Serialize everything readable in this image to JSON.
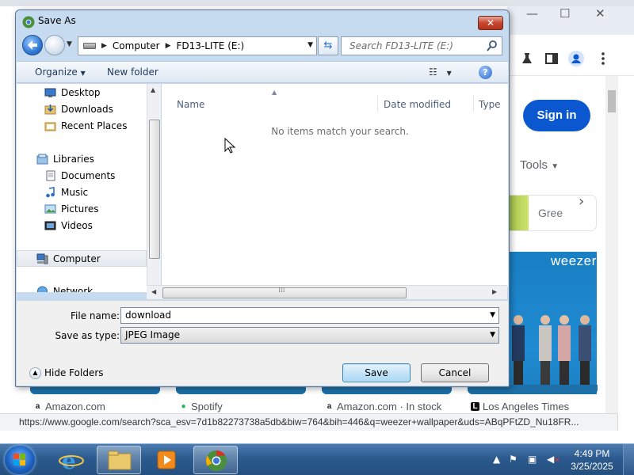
{
  "browser": {
    "window_controls": [
      "—",
      "☐",
      "✕"
    ],
    "sign_in": "Sign in",
    "tools": "Tools",
    "result_text": "Gree",
    "image_logo": "weezer",
    "sources": [
      {
        "name": "Amazon.com",
        "color": "#222222",
        "glyph": "a"
      },
      {
        "name": "Spotify",
        "color": "#1db954",
        "glyph": "●"
      },
      {
        "name": "Amazon.com · In stock",
        "color": "#222222",
        "glyph": "a"
      },
      {
        "name": "Los Angeles Times",
        "color": "#111111",
        "glyph": "L"
      }
    ],
    "status_url": "https://www.google.com/search?sca_esv=7d1b82273738a5db&biw=764&bih=446&q=weezer+wallpaper&uds=ABqPFtZD_Nu18FR..."
  },
  "dialog": {
    "title": "Save As",
    "close_label": "✕",
    "address": {
      "segments": [
        "Computer",
        "FD13-LITE (E:)"
      ]
    },
    "search_placeholder": "Search FD13-LITE (E:)",
    "toolbar": {
      "organize": "Organize",
      "new_folder": "New folder"
    },
    "nav_items": [
      {
        "label": "Desktop",
        "icon": "desktop-icon"
      },
      {
        "label": "Downloads",
        "icon": "downloads-icon"
      },
      {
        "label": "Recent Places",
        "icon": "recent-places-icon"
      },
      {
        "label": "Libraries",
        "icon": "libraries-icon"
      },
      {
        "label": "Documents",
        "icon": "documents-icon"
      },
      {
        "label": "Music",
        "icon": "music-icon"
      },
      {
        "label": "Pictures",
        "icon": "pictures-icon"
      },
      {
        "label": "Videos",
        "icon": "videos-icon"
      },
      {
        "label": "Computer",
        "icon": "computer-icon"
      },
      {
        "label": "Network",
        "icon": "network-icon"
      }
    ],
    "columns": [
      "Name",
      "Date modified",
      "Type"
    ],
    "empty_message": "No items match your search.",
    "file_name_label": "File name:",
    "file_name_value": "download",
    "save_type_label": "Save as type:",
    "save_type_value": "JPEG Image",
    "hide_folders": "Hide Folders",
    "save_button": "Save",
    "cancel_button": "Cancel"
  },
  "taskbar": {
    "time": "4:49 PM",
    "date": "3/25/2025",
    "apps": [
      "internet-explorer",
      "file-explorer",
      "media-player",
      "chrome"
    ]
  }
}
